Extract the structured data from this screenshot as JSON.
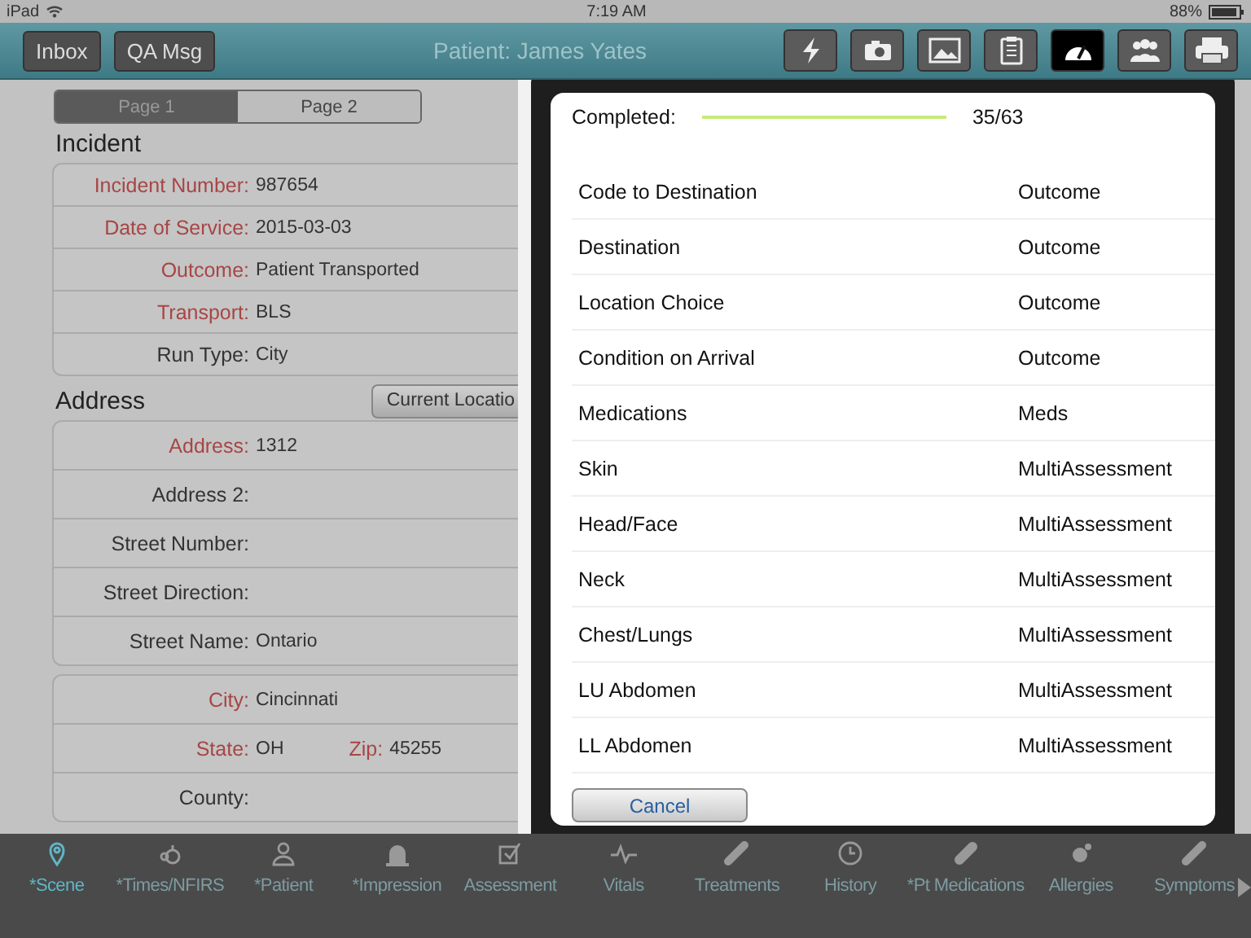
{
  "status_bar": {
    "device": "iPad",
    "time": "7:19 AM",
    "battery": "88%"
  },
  "header": {
    "buttons": [
      "Inbox",
      "QA Msg"
    ],
    "title": "Patient: James Yates",
    "tools": [
      {
        "kind": "lightning",
        "selected": false
      },
      {
        "kind": "camera",
        "selected": false
      },
      {
        "kind": "image",
        "selected": false
      },
      {
        "kind": "clipboard",
        "selected": false
      },
      {
        "kind": "gauge",
        "selected": true
      },
      {
        "kind": "people",
        "selected": false
      },
      {
        "kind": "printer",
        "selected": false
      }
    ]
  },
  "pages": [
    {
      "label": "Page 1",
      "selected": true
    },
    {
      "label": "Page 2",
      "selected": false
    }
  ],
  "sections": [
    {
      "title": "Incident",
      "groups": [
        [
          {
            "cells": [
              {
                "label": "Incident Number:",
                "value": "987654",
                "required": true
              }
            ]
          },
          {
            "cells": [
              {
                "label": "Date of Service:",
                "value": "2015-03-03",
                "required": true
              }
            ]
          },
          {
            "cells": [
              {
                "label": "Outcome:",
                "value": "Patient Transported",
                "required": true
              }
            ]
          },
          {
            "cells": [
              {
                "label": "Transport:",
                "value": "BLS",
                "required": true
              }
            ]
          },
          {
            "cells": [
              {
                "label": "Run Type:",
                "value": "City",
                "required": false
              }
            ]
          }
        ]
      ]
    },
    {
      "title": "Address",
      "action": "Current Locatio",
      "groups": [
        [
          {
            "cells": [
              {
                "label": "Address:",
                "value": "1312",
                "required": true
              }
            ]
          },
          {
            "cells": [
              {
                "label": "Address 2:",
                "required": false
              }
            ]
          },
          {
            "cells": [
              {
                "label": "Street Number:",
                "required": false
              }
            ]
          },
          {
            "cells": [
              {
                "label": "Street Direction:",
                "required": false
              }
            ]
          },
          {
            "cells": [
              {
                "label": "Street Name:",
                "value": "Ontario",
                "required": false
              }
            ]
          }
        ],
        [
          {
            "cells": [
              {
                "label": "City:",
                "value": "Cincinnati",
                "required": true
              }
            ]
          },
          {
            "cells": [
              {
                "label": "State:",
                "value": "OH",
                "required": true
              },
              {
                "label": "Zip:",
                "value": "45255",
                "required": true
              }
            ]
          },
          {
            "cells": [
              {
                "label": "County:",
                "required": false
              }
            ]
          }
        ]
      ]
    }
  ],
  "popover": {
    "progress_label": "Completed:",
    "level": 1,
    "progress_text": "35/63",
    "items": [
      {
        "name": "Code to Destination",
        "section": "Outcome"
      },
      {
        "name": "Destination",
        "section": "Outcome"
      },
      {
        "name": "Location Choice",
        "section": "Outcome"
      },
      {
        "name": "Condition on Arrival",
        "section": "Outcome"
      },
      {
        "name": "Medications",
        "section": "Meds"
      },
      {
        "name": "Skin",
        "section": "MultiAssessment"
      },
      {
        "name": "Head/Face",
        "section": "MultiAssessment"
      },
      {
        "name": "Neck",
        "section": "MultiAssessment"
      },
      {
        "name": "Chest/Lungs",
        "section": "MultiAssessment"
      },
      {
        "name": "LU Abdomen",
        "section": "MultiAssessment"
      },
      {
        "name": "LL Abdomen",
        "section": "MultiAssessment"
      }
    ],
    "cancel": "Cancel"
  },
  "tab_bar": [
    {
      "label": "*Scene",
      "selected": true
    },
    {
      "label": "*Times/NFIRS",
      "selected": false
    },
    {
      "label": "*Patient",
      "selected": false
    },
    {
      "label": "*Impression",
      "selected": false
    },
    {
      "label": "Assessment",
      "selected": false
    },
    {
      "label": "Vitals",
      "selected": false
    },
    {
      "label": "Treatments",
      "selected": false
    },
    {
      "label": "History",
      "selected": false
    },
    {
      "label": "*Pt Medications",
      "selected": false
    },
    {
      "label": "Allergies",
      "selected": false
    },
    {
      "label": "Symptoms",
      "selected": false
    }
  ]
}
